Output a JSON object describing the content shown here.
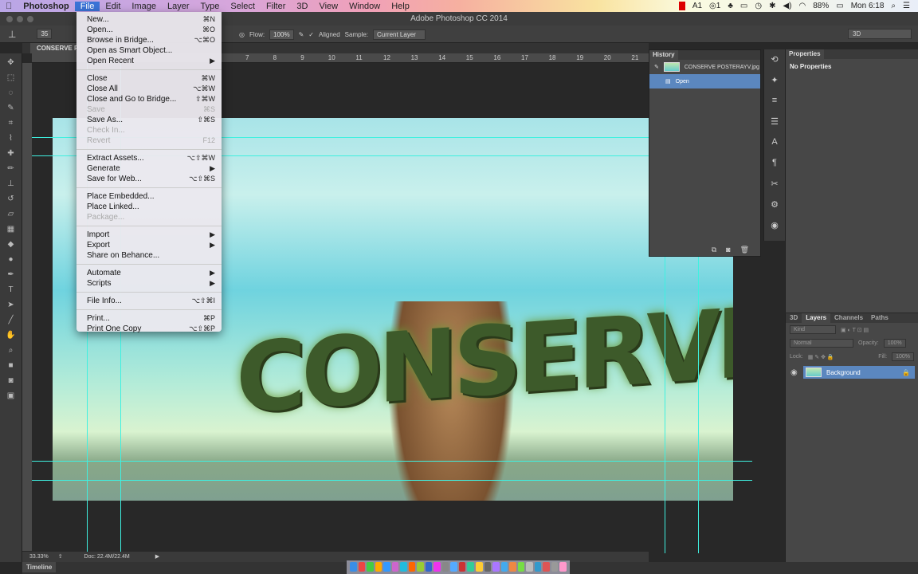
{
  "menubar": {
    "apple": "",
    "app": "Photoshop",
    "items": [
      "File",
      "Edit",
      "Image",
      "Layer",
      "Type",
      "Select",
      "Filter",
      "3D",
      "View",
      "Window",
      "Help"
    ],
    "status": {
      "ai_badge": "1",
      "cc_badge": "1",
      "battery": "88%",
      "clock": "Mon 6:18"
    }
  },
  "window": {
    "title": "Adobe Photoshop CC 2014"
  },
  "options": {
    "brush_size": "35",
    "flow_label": "Flow:",
    "flow_value": "100%",
    "aligned_label": "Aligned",
    "sample_label": "Sample:",
    "sample_value": "Current Layer",
    "workspace": "3D"
  },
  "document": {
    "tab": "CONSERVE P",
    "ruler": [
      "7",
      "8",
      "9",
      "10",
      "11",
      "12",
      "13",
      "14",
      "15",
      "16",
      "17",
      "18",
      "19",
      "20",
      "21"
    ],
    "word": "CONSERVE"
  },
  "file_menu": {
    "groups": [
      [
        {
          "label": "New...",
          "shortcut": "⌘N"
        },
        {
          "label": "Open...",
          "shortcut": "⌘O"
        },
        {
          "label": "Browse in Bridge...",
          "shortcut": "⌥⌘O"
        },
        {
          "label": "Open as Smart Object...",
          "shortcut": ""
        },
        {
          "label": "Open Recent",
          "shortcut": "▶"
        }
      ],
      [
        {
          "label": "Close",
          "shortcut": "⌘W"
        },
        {
          "label": "Close All",
          "shortcut": "⌥⌘W"
        },
        {
          "label": "Close and Go to Bridge...",
          "shortcut": "⇧⌘W"
        },
        {
          "label": "Save",
          "shortcut": "⌘S",
          "disabled": true
        },
        {
          "label": "Save As...",
          "shortcut": "⇧⌘S"
        },
        {
          "label": "Check In...",
          "shortcut": "",
          "disabled": true
        },
        {
          "label": "Revert",
          "shortcut": "F12",
          "disabled": true
        }
      ],
      [
        {
          "label": "Extract Assets...",
          "shortcut": "⌥⇧⌘W"
        },
        {
          "label": "Generate",
          "shortcut": "▶"
        },
        {
          "label": "Save for Web...",
          "shortcut": "⌥⇧⌘S"
        }
      ],
      [
        {
          "label": "Place Embedded...",
          "shortcut": ""
        },
        {
          "label": "Place Linked...",
          "shortcut": ""
        },
        {
          "label": "Package...",
          "shortcut": "",
          "disabled": true
        }
      ],
      [
        {
          "label": "Import",
          "shortcut": "▶"
        },
        {
          "label": "Export",
          "shortcut": "▶"
        },
        {
          "label": "Share on Behance...",
          "shortcut": ""
        }
      ],
      [
        {
          "label": "Automate",
          "shortcut": "▶"
        },
        {
          "label": "Scripts",
          "shortcut": "▶"
        }
      ],
      [
        {
          "label": "File Info...",
          "shortcut": "⌥⇧⌘I"
        }
      ],
      [
        {
          "label": "Print...",
          "shortcut": "⌘P"
        },
        {
          "label": "Print One Copy",
          "shortcut": "⌥⇧⌘P"
        }
      ]
    ]
  },
  "history": {
    "title": "History",
    "snapshot": "CONSERVE POSTERAYV.jpg",
    "step": "Open"
  },
  "properties": {
    "title": "Properties",
    "empty": "No Properties"
  },
  "layers": {
    "tabs": [
      "3D",
      "Layers",
      "Channels",
      "Paths"
    ],
    "kind": "Kind",
    "blend": "Normal",
    "opacity_label": "Opacity:",
    "opacity": "100%",
    "lock_label": "Lock:",
    "fill_label": "Fill:",
    "fill": "100%",
    "layer": "Background"
  },
  "status": {
    "zoom": "33.33%",
    "doc": "Doc: 22.4M/22.4M"
  },
  "timeline": {
    "label": "Timeline"
  }
}
